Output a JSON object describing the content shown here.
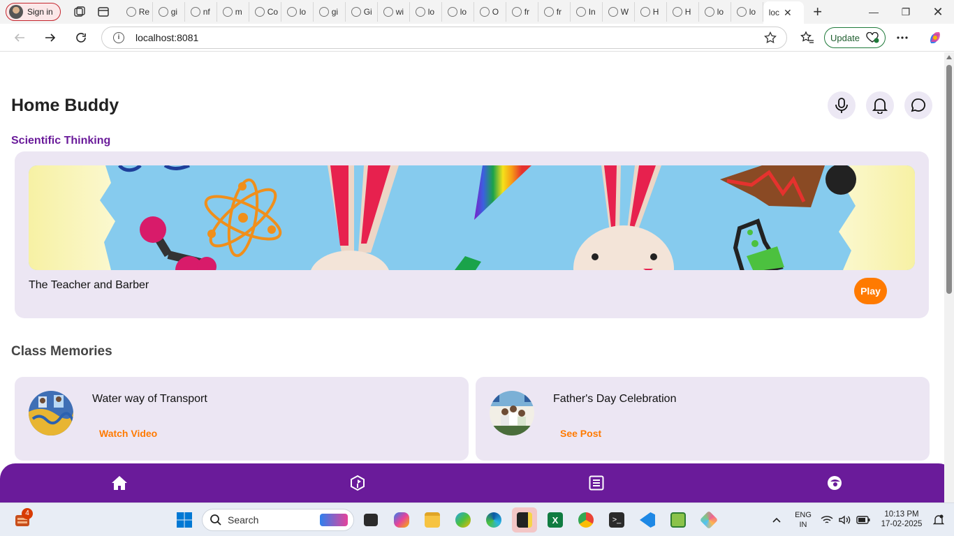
{
  "browser": {
    "signin_label": "Sign in",
    "tabs": [
      "Re",
      "gi",
      "nf",
      "m",
      "Co",
      "lo",
      "gi",
      "Gi",
      "wi",
      "lo",
      "lo",
      "O",
      "fr",
      "fr",
      "In",
      "W",
      "H",
      "H",
      "lo",
      "lo"
    ],
    "active_tab": "loc",
    "url": "localhost:8081",
    "update_label": "Update"
  },
  "app": {
    "title": "Home Buddy",
    "section_title": "Scientific Thinking",
    "story": {
      "title": "The Teacher and Barber",
      "play_label": "Play"
    },
    "memories_title": "Class Memories",
    "memories": [
      {
        "title": "Water way of Transport",
        "action": "Watch Video"
      },
      {
        "title": "Father's Day Celebration",
        "action": "See Post"
      }
    ],
    "nav_items": [
      "home-icon",
      "cube-icon",
      "list-icon",
      "profile-icon"
    ]
  },
  "taskbar": {
    "search_placeholder": "Search",
    "badge_count": "4",
    "lang_line1": "ENG",
    "lang_line2": "IN",
    "time": "10:13 PM",
    "date": "17-02-2025"
  },
  "colors": {
    "brand": "#6a1b9a",
    "accent": "#ff7a00",
    "card": "#ece6f3"
  }
}
